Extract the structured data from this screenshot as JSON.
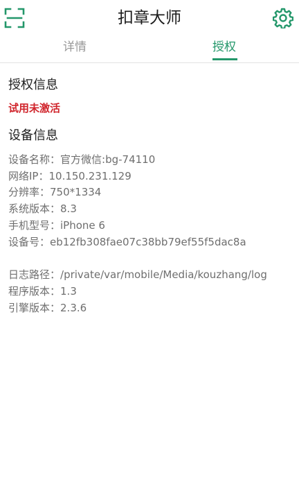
{
  "header": {
    "title": "扣章大师",
    "scan_icon": "scan-frame-icon",
    "settings_icon": "gear-icon"
  },
  "tabs": [
    {
      "label": "详情",
      "active": false
    },
    {
      "label": "授权",
      "active": true
    }
  ],
  "auth": {
    "title": "授权信息",
    "status": "试用未激活"
  },
  "device": {
    "title": "设备信息",
    "rows": [
      {
        "label": "设备名称：",
        "value": "官方微信:bg-74110"
      },
      {
        "label": "网络IP：",
        "value": "10.150.231.129"
      },
      {
        "label": "分辨率：",
        "value": "750*1334"
      },
      {
        "label": "系统版本：",
        "value": "8.3"
      },
      {
        "label": "手机型号：",
        "value": "iPhone 6"
      },
      {
        "label": "设备号：",
        "value": "eb12fb308fae07c38bb79ef55f5dac8a"
      }
    ],
    "extra_rows": [
      {
        "label": "日志路径：",
        "value": "/private/var/mobile/Media/kouzhang/log"
      },
      {
        "label": "程序版本：",
        "value": "1.3"
      },
      {
        "label": "引擎版本：",
        "value": "2.3.6"
      }
    ]
  },
  "colors": {
    "accent": "#23976a",
    "status_red": "#d0242b",
    "info_text": "#6e6e6e"
  }
}
